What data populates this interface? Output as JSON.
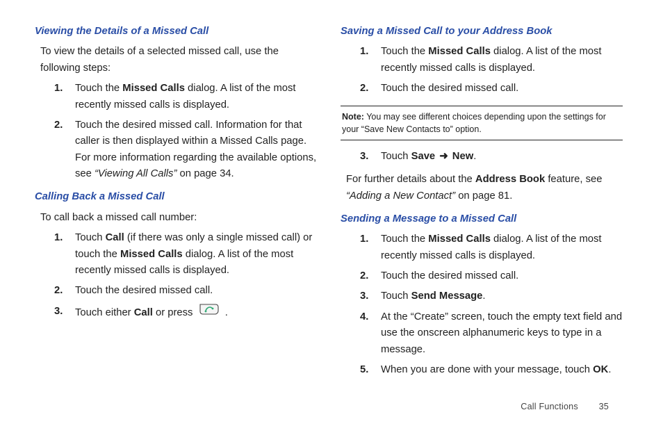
{
  "left": {
    "h1": "Viewing the Details of a Missed Call",
    "intro1": "To view the details of a selected missed call, use the following steps:",
    "steps1": [
      {
        "pre": "Touch the ",
        "bold": "Missed Calls",
        "post": " dialog. A list of the most recently missed calls is displayed."
      },
      {
        "pre": "Touch the desired missed call. Information for that caller is then displayed within a Missed Calls page. For more information regarding the available options, see ",
        "ref": "“Viewing All Calls”",
        "post": " on page 34."
      }
    ],
    "h2": "Calling Back a Missed Call",
    "intro2": "To call back a missed call number:",
    "steps2": [
      {
        "pre": "Touch ",
        "bold": "Call",
        "mid": " (if there was only a single missed call) or touch the ",
        "bold2": "Missed Calls",
        "post": " dialog. A list of the most recently missed calls is displayed."
      },
      {
        "text": "Touch the desired missed call."
      },
      {
        "pre": "Touch either ",
        "bold": "Call",
        "mid": " or press ",
        "icon": "call-key-icon",
        "post": " ."
      }
    ]
  },
  "right": {
    "h1": "Saving a Missed Call to your Address Book",
    "steps1": [
      {
        "pre": "Touch the ",
        "bold": "Missed Calls",
        "post": " dialog. A list of the most recently missed calls is displayed."
      },
      {
        "text": "Touch the desired missed call."
      }
    ],
    "note_label": "Note:",
    "note_text": " You may see different choices depending upon the settings for your “Save New Contacts to” option.",
    "steps1b_start": 3,
    "steps1b": [
      {
        "pre": "Touch ",
        "bold": "Save",
        "arrow": " ➜ ",
        "bold2": "New",
        "post": "."
      }
    ],
    "after1b_pre": "For further details about the ",
    "after1b_bold": "Address Book",
    "after1b_mid": " feature, see ",
    "after1b_ref": "“Adding a New Contact”",
    "after1b_post": " on page 81.",
    "h2": "Sending a Message to a Missed Call",
    "steps2": [
      {
        "pre": "Touch the ",
        "bold": "Missed Calls",
        "post": " dialog. A list of the most recently missed calls is displayed."
      },
      {
        "text": "Touch the desired missed call."
      },
      {
        "pre": "Touch ",
        "bold": "Send Message",
        "post": "."
      },
      {
        "text": "At the “Create” screen, touch the empty text field and use the onscreen alphanumeric keys to type in a message."
      },
      {
        "pre": "When you are done with your message, touch ",
        "bold": "OK",
        "post": "."
      }
    ]
  },
  "footer": {
    "section": "Call Functions",
    "page": "35"
  }
}
